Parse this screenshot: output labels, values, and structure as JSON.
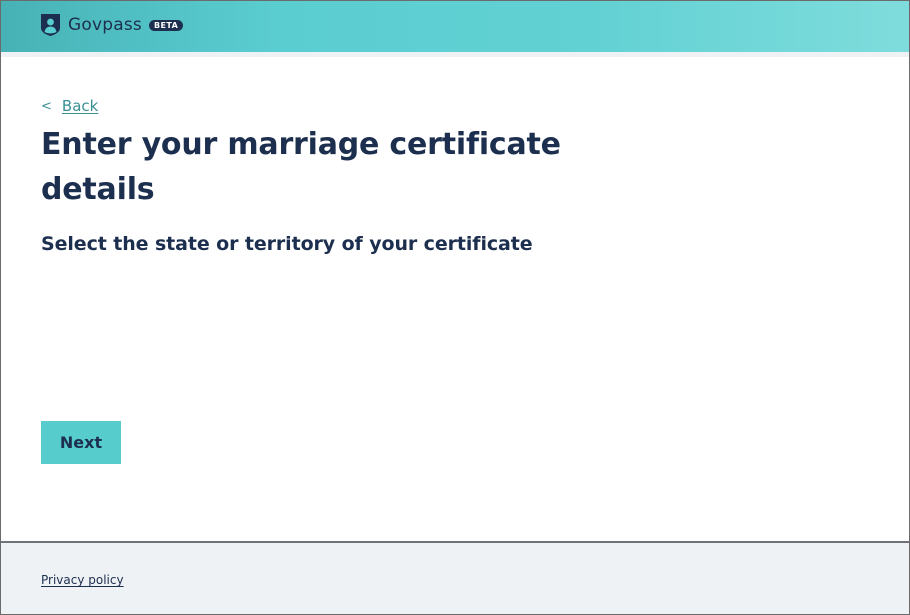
{
  "header": {
    "brand_name": "Govpass",
    "badge": "BETA",
    "logo_icon": "shield-person-icon"
  },
  "nav": {
    "back_chevron": "<",
    "back_label": "Back"
  },
  "main": {
    "title": "Enter your marriage certificate details",
    "question": "Select the state or territory of your certificate",
    "next_label": "Next"
  },
  "footer": {
    "privacy_label": "Privacy policy"
  },
  "colors": {
    "header_gradient_start": "#47b2b6",
    "header_gradient_end": "#7fdcdc",
    "primary_text": "#1d2f4e",
    "link": "#3a8f94",
    "button": "#56cccd",
    "footer_bg": "#eef2f5"
  }
}
